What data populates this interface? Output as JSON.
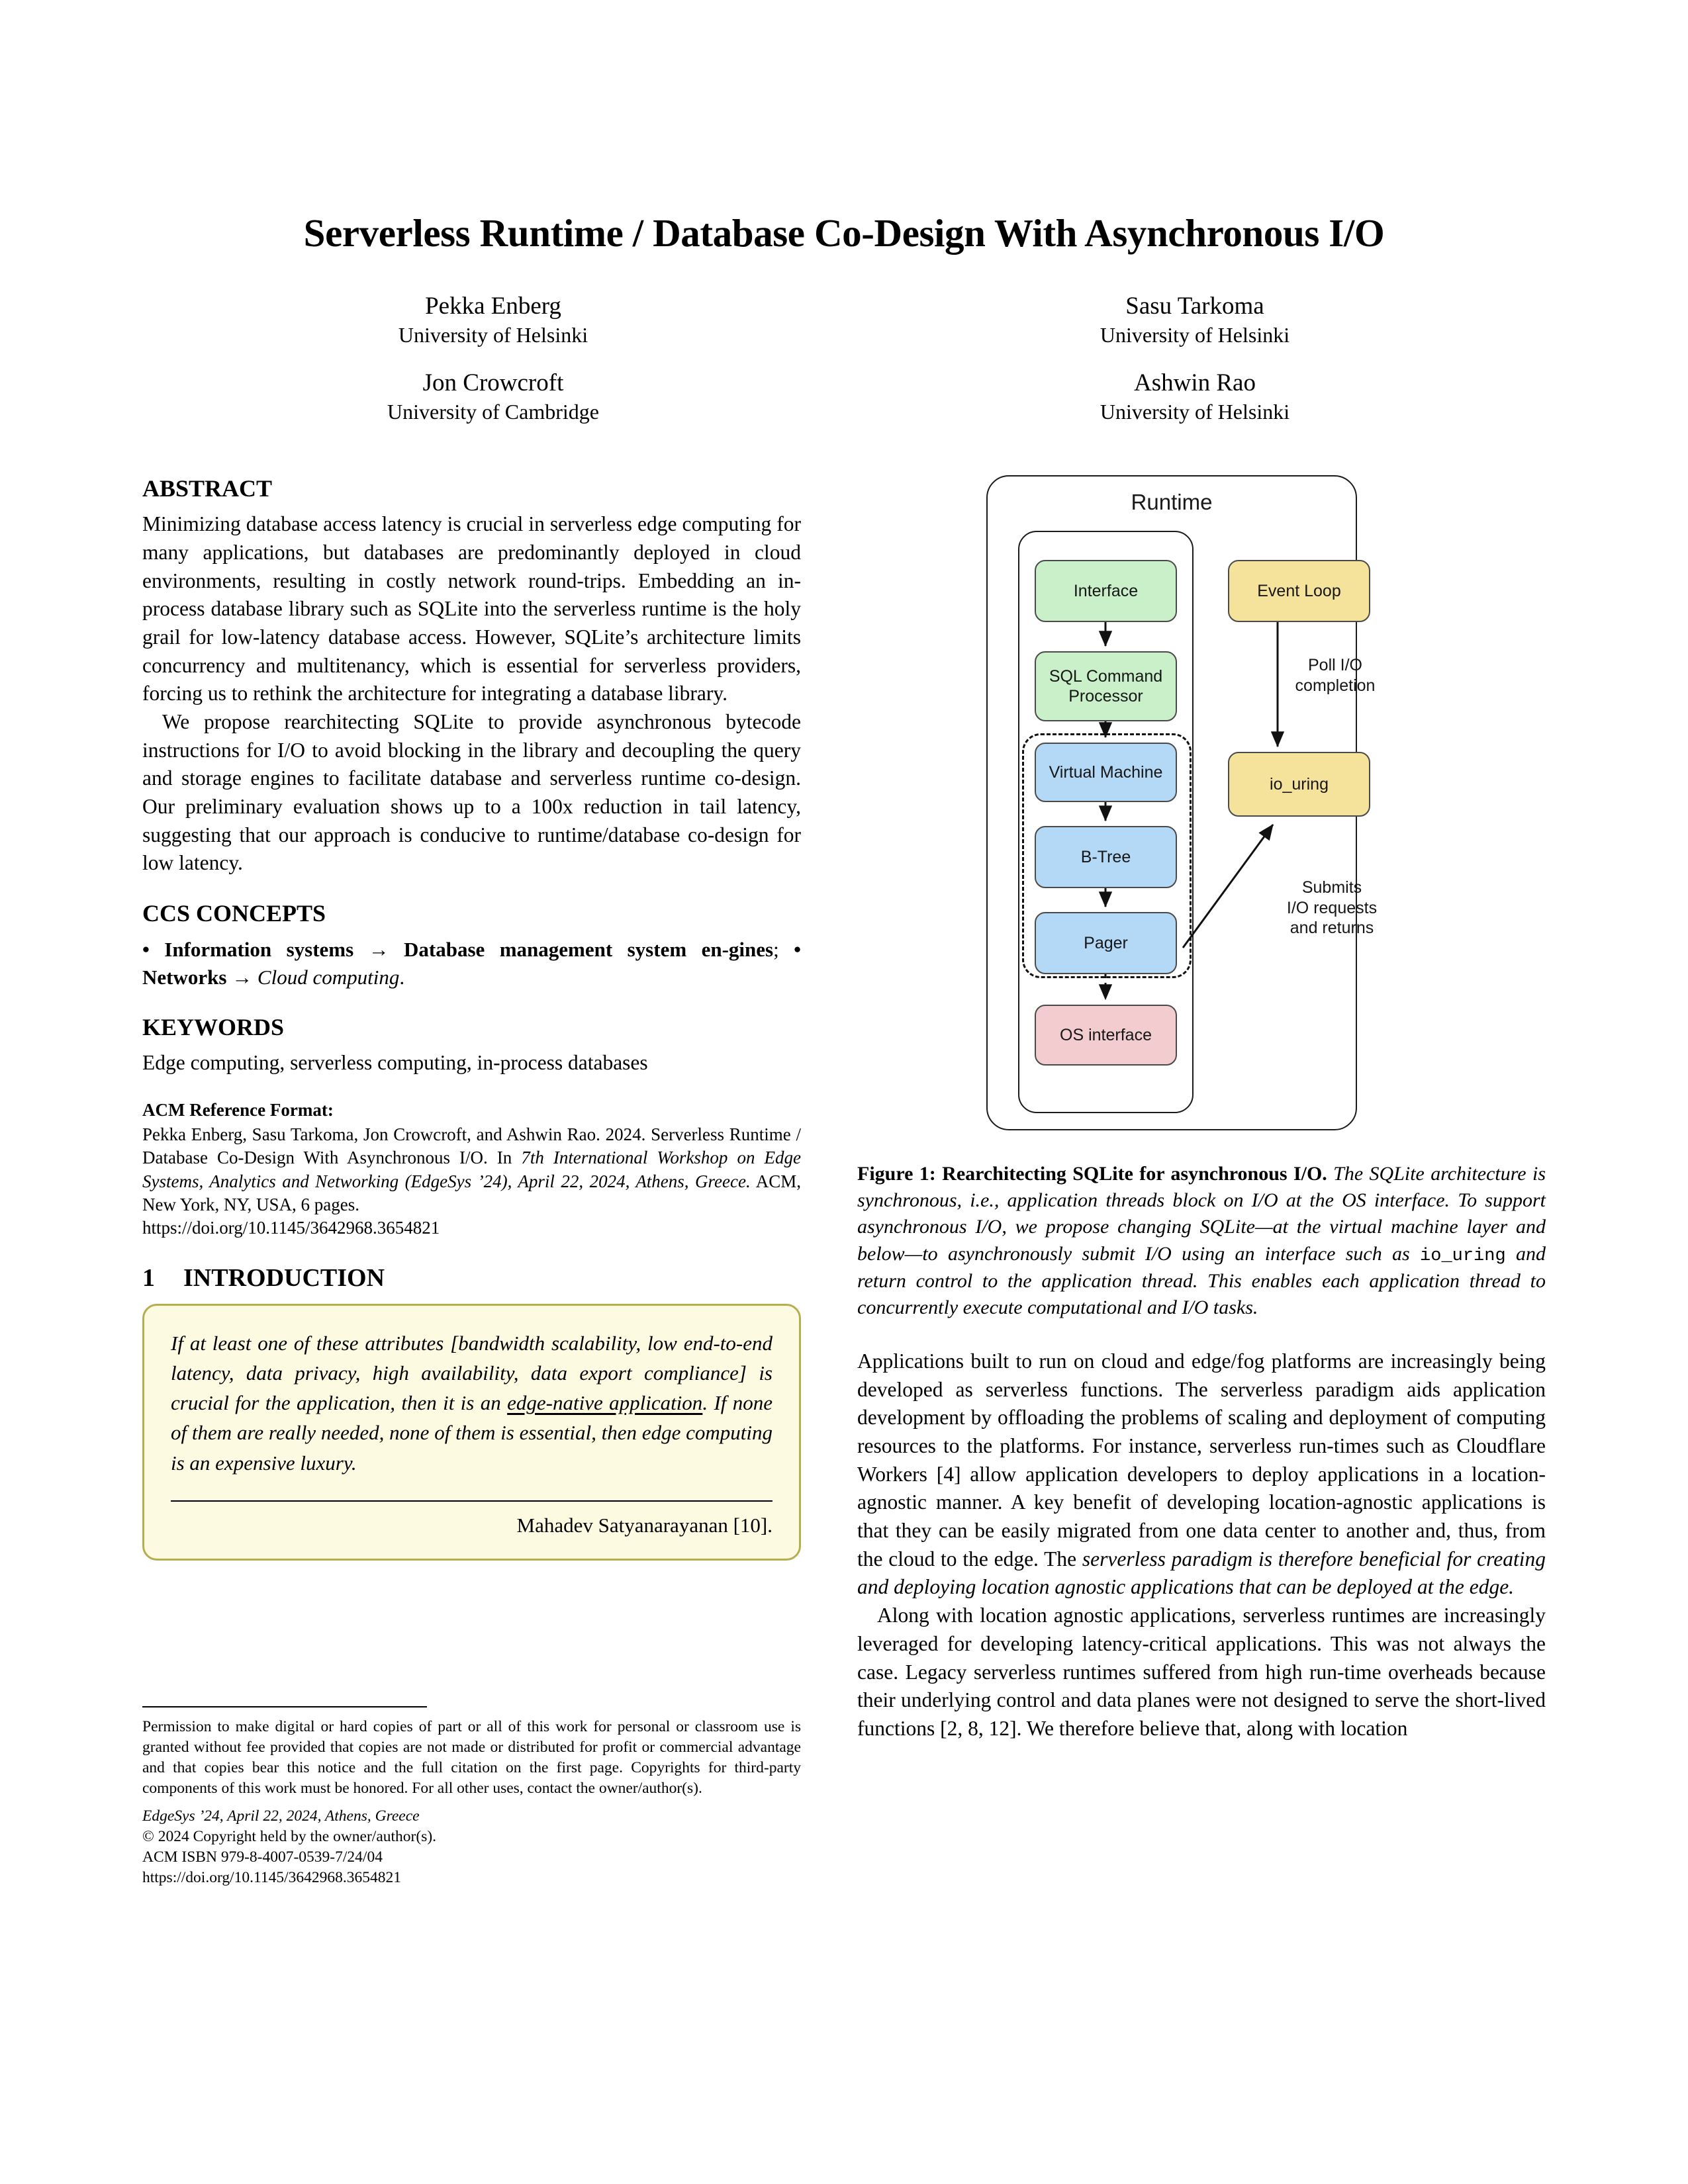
{
  "paper": {
    "title": "Serverless Runtime / Database Co-Design With Asynchronous I/O",
    "authors": [
      {
        "name": "Pekka Enberg",
        "affiliation": "University of Helsinki"
      },
      {
        "name": "Sasu Tarkoma",
        "affiliation": "University of Helsinki"
      },
      {
        "name": "Jon Crowcroft",
        "affiliation": "University of Cambridge"
      },
      {
        "name": "Ashwin Rao",
        "affiliation": "University of Helsinki"
      }
    ]
  },
  "abstract": {
    "heading": "ABSTRACT",
    "paragraph1": "Minimizing database access latency is crucial in serverless edge computing for many applications, but databases are predominantly deployed in cloud environments, resulting in costly network round-trips. Embedding an in-process database library such as SQLite into the serverless runtime is the holy grail for low-latency database access. However, SQLite’s architecture limits concurrency and multitenancy, which is essential for serverless providers, forcing us to rethink the architecture for integrating a database library.",
    "paragraph2": "We propose rearchitecting SQLite to provide asynchronous bytecode instructions for I/O to avoid blocking in the library and decoupling the query and storage engines to facilitate database and serverless runtime co-design. Our preliminary evaluation shows up to a 100x reduction in tail latency, suggesting that our approach is conducive to runtime/database co-design for low latency."
  },
  "ccs": {
    "heading": "CCS CONCEPTS",
    "part1": "• Information systems → Database management system en-",
    "part2": "gines",
    "separator": "; ",
    "part3": "• Networks → ",
    "part4": "Cloud computing",
    "part5": "."
  },
  "keywords": {
    "heading": "KEYWORDS",
    "text": "Edge computing, serverless computing, in-process databases"
  },
  "acm_reference": {
    "heading": "ACM Reference Format:",
    "line1": "Pekka Enberg, Sasu Tarkoma, Jon Crowcroft, and Ashwin Rao. 2024. Serverless Runtime / Database Co-Design With Asynchronous I/O. In ",
    "venue_italic": "7th International Workshop on Edge Systems, Analytics and Networking (EdgeSys ’24), April 22, 2024, Athens, Greece.",
    "line2": " ACM, New York, NY, USA, 6 pages.",
    "doi": "https://doi.org/10.1145/3642968.3654821"
  },
  "introduction": {
    "number": "1",
    "heading": "INTRODUCTION",
    "quote": {
      "text_before_underline": "If at least one of these attributes [bandwidth scalability, low end-to-end latency, data privacy, high availability, data export compliance] is crucial for the application, then it is an ",
      "underlined": "edge-native application",
      "text_after_underline": ". If none of them are really needed, none of them is essential, then edge computing is an expensive luxury.",
      "attribution": "Mahadev Satyanarayanan [10]."
    }
  },
  "copyright": {
    "permission": "Permission to make digital or hard copies of part or all of this work for personal or classroom use is granted without fee provided that copies are not made or distributed for profit or commercial advantage and that copies bear this notice and the full citation on the first page. Copyrights for third-party components of this work must be honored. For all other uses, contact the owner/author(s).",
    "venue": "EdgeSys ’24, April 22, 2024, Athens, Greece",
    "held_by": "© 2024 Copyright held by the owner/author(s).",
    "isbn": "ACM ISBN 979-8-4007-0539-7/24/04",
    "doi": "https://doi.org/10.1145/3642968.3654821"
  },
  "figure": {
    "diagram": {
      "container_label": "Runtime",
      "nodes": [
        {
          "id": "interface",
          "label": "Interface",
          "color": "#c9f0c9"
        },
        {
          "id": "sql-command-processor",
          "label": "SQL Command Processor",
          "color": "#c9f0c9"
        },
        {
          "id": "virtual-machine",
          "label": "Virtual Machine",
          "color": "#b3d9f7"
        },
        {
          "id": "b-tree",
          "label": "B-Tree",
          "color": "#b3d9f7"
        },
        {
          "id": "pager",
          "label": "Pager",
          "color": "#b3d9f7"
        },
        {
          "id": "os-interface",
          "label": "OS interface",
          "color": "#f2ccce"
        },
        {
          "id": "event-loop",
          "label": "Event Loop",
          "color": "#f5e39b"
        },
        {
          "id": "io-uring",
          "label": "io_uring",
          "color": "#f5e39b"
        }
      ],
      "edge_labels": [
        {
          "id": "poll-io-completion",
          "line1": "Poll I/O",
          "line2": "completion"
        },
        {
          "id": "submits-io",
          "line1": "Submits",
          "line2": "I/O requests",
          "line3": "and returns"
        }
      ]
    },
    "caption": {
      "bold_part": "Figure 1: Rearchitecting SQLite for asynchronous I/O.",
      "italic_part1": " The SQLite architecture is synchronous, i.e., application threads block on I/O at the OS interface. To support asynchronous I/O, we propose changing SQLite—at the virtual machine layer and below—to asynchronously submit I/O using an interface such as ",
      "mono": "io_uring",
      "italic_part2": " and return control to the application thread. This enables each application thread to concurrently execute computational and I/O tasks."
    }
  },
  "right_column_body": {
    "paragraph1_pre": "Applications built to run on cloud and edge/fog platforms are increasingly being developed as serverless functions. The serverless paradigm aids application development by offloading the problems of scaling and deployment of computing resources to the platforms. For instance, serverless run-times such as Cloudflare Workers [4] allow application developers to deploy applications in a location-agnostic manner. A key benefit of developing location-agnostic applications is that they can be easily migrated from one data center to another and, thus, from the cloud to the edge. The ",
    "paragraph1_italic": "serverless paradigm is therefore beneficial for creating and deploying location agnostic applications that can be deployed at the edge.",
    "paragraph2": "Along with location agnostic applications, serverless runtimes are increasingly leveraged for developing latency-critical applications. This was not always the case. Legacy serverless runtimes suffered from high run-time overheads because their underlying control and data planes were not designed to serve the short-lived functions [2, 8, 12]. We therefore believe that, along with location"
  }
}
